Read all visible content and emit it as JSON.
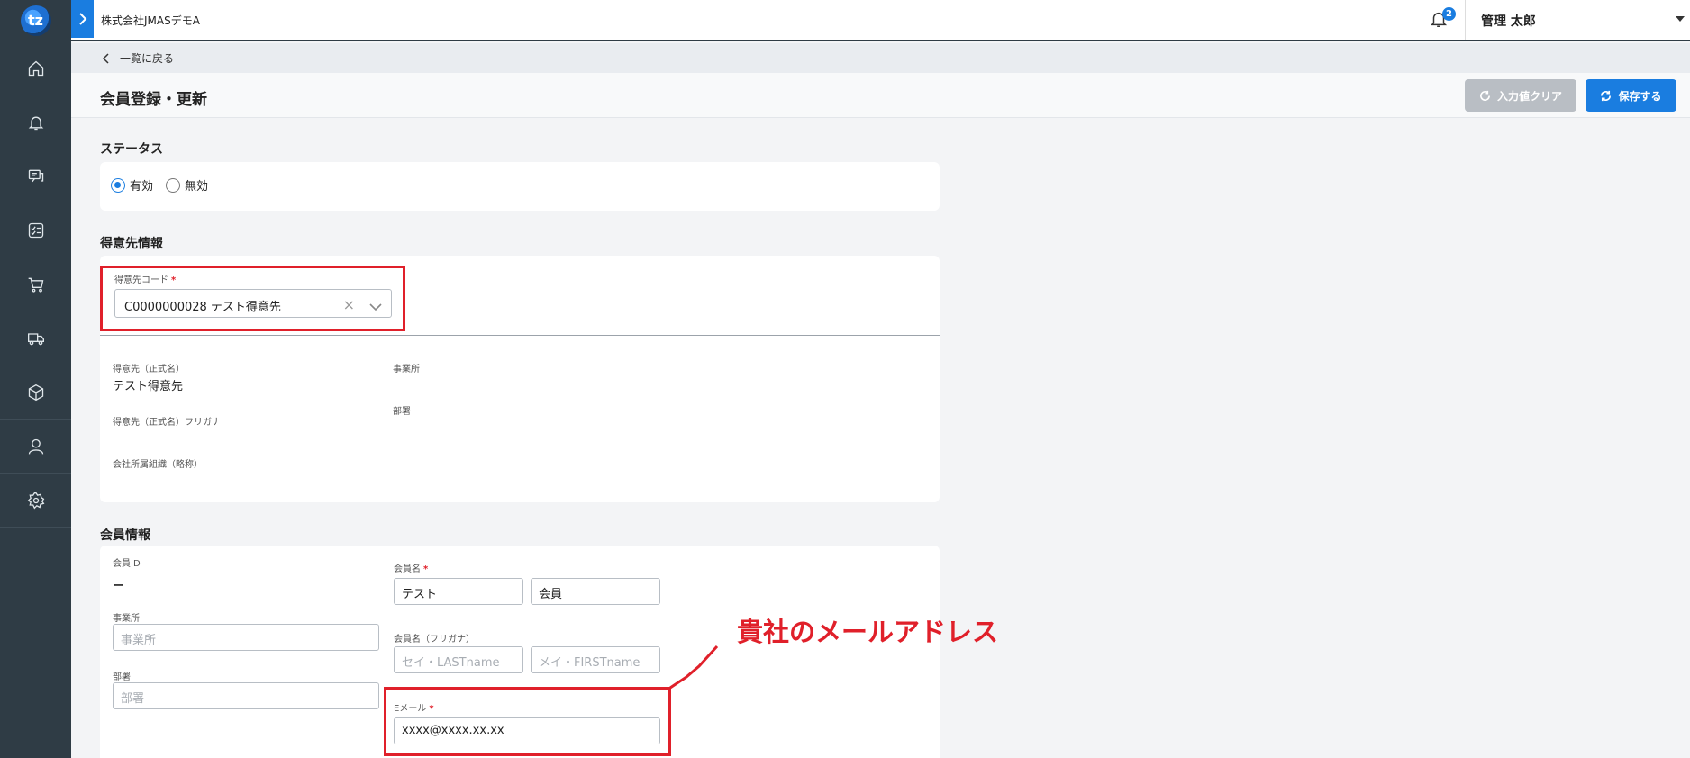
{
  "topbar": {
    "company_name": "株式会社JMASデモA",
    "notification_count": "2",
    "user_name": "管理 太郎"
  },
  "sidebar": {
    "items": [
      {
        "icon": "home-icon"
      },
      {
        "icon": "bell-icon"
      },
      {
        "icon": "chat-icon"
      },
      {
        "icon": "checklist-icon"
      },
      {
        "icon": "cart-icon"
      },
      {
        "icon": "truck-icon"
      },
      {
        "icon": "box-icon"
      },
      {
        "icon": "user-icon"
      },
      {
        "icon": "gear-icon"
      }
    ]
  },
  "breadcrumb": {
    "back_label": "一覧に戻る"
  },
  "page": {
    "title": "会員登録・更新",
    "clear_button": "入力値クリア",
    "save_button": "保存する"
  },
  "status": {
    "section_title": "ステータス",
    "options": [
      "有効",
      "無効"
    ],
    "selected": "有効"
  },
  "customer": {
    "section_title": "得意先情報",
    "code_label": "得意先コード",
    "required_mark": "*",
    "code_value": "C0000000028 テスト得意先",
    "clear_glyph": "×",
    "formal_name_label": "得意先（正式名）",
    "formal_name_value": "テスト得意先",
    "formal_kana_label": "得意先（正式名）フリガナ",
    "org_label": "会社所属組織（略称）",
    "office_label": "事業所",
    "dept_label": "部署"
  },
  "member": {
    "section_title": "会員情報",
    "id_label": "会員ID",
    "id_value": "ー",
    "office_label": "事業所",
    "office_placeholder": "事業所",
    "dept_label": "部署",
    "dept_placeholder": "部署",
    "name_label": "会員名",
    "last_name_value": "テスト",
    "first_name_value": "会員",
    "kana_label": "会員名（フリガナ）",
    "kana_last_placeholder": "セイ・LASTname",
    "kana_first_placeholder": "メイ・FIRSTname",
    "email_label": "Eメール",
    "email_value": "xxxx@xxxx.xx.xx",
    "required_mark": "*"
  },
  "annotation": {
    "text": "貴社のメールアドレス",
    "color": "#e0202a"
  },
  "colors": {
    "primary": "#1a7de0",
    "sidebar": "#2f3c45",
    "disabled_button": "#b9bec4",
    "required": "#e0202a"
  }
}
